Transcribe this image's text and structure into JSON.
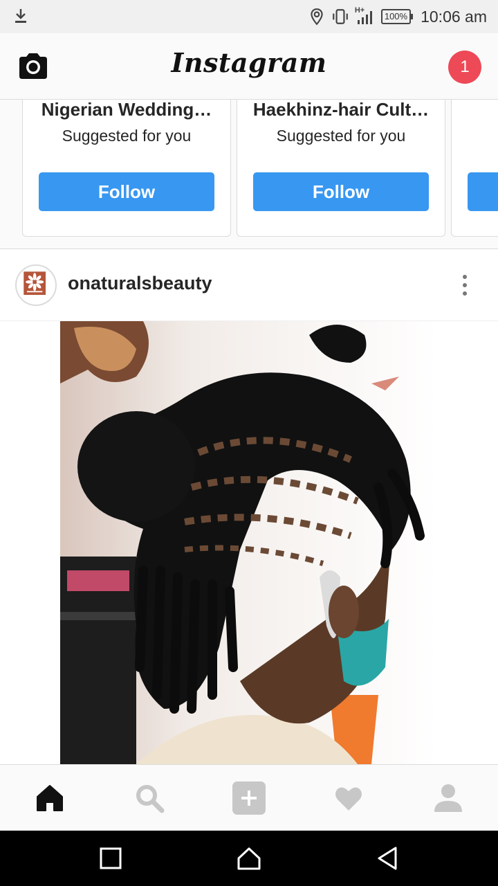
{
  "status_bar": {
    "icons": [
      "download-icon",
      "location-icon",
      "vibrate-icon",
      "signal-icon"
    ],
    "network_label": "H+",
    "battery": "100%",
    "time": "10:06 am"
  },
  "header": {
    "logo": "Instagram",
    "camera_icon": "camera-icon",
    "notification_count": "1"
  },
  "suggestions": [
    {
      "name": "Nigerian Wedding…",
      "subtitle": "Suggested for you",
      "button": "Follow"
    },
    {
      "name": "Haekhinz-hair Cult…",
      "subtitle": "Suggested for you",
      "button": "Follow"
    }
  ],
  "post": {
    "username": "onaturalsbeauty",
    "avatar_icon": "brand-logo-avatar",
    "more_icon": "more-options-icon",
    "image": "hair-twists-photo"
  },
  "tab_bar": {
    "tabs": [
      "home-icon",
      "search-icon",
      "add-post-icon",
      "activity-heart-icon",
      "profile-icon"
    ],
    "active": "home-icon"
  },
  "android_nav": [
    "recents-icon",
    "home-icon",
    "back-icon"
  ],
  "colors": {
    "follow_blue": "#3897f0",
    "badge_red": "#ed4956",
    "text_dark": "#262626",
    "inactive_icon": "#c7c7c7"
  }
}
